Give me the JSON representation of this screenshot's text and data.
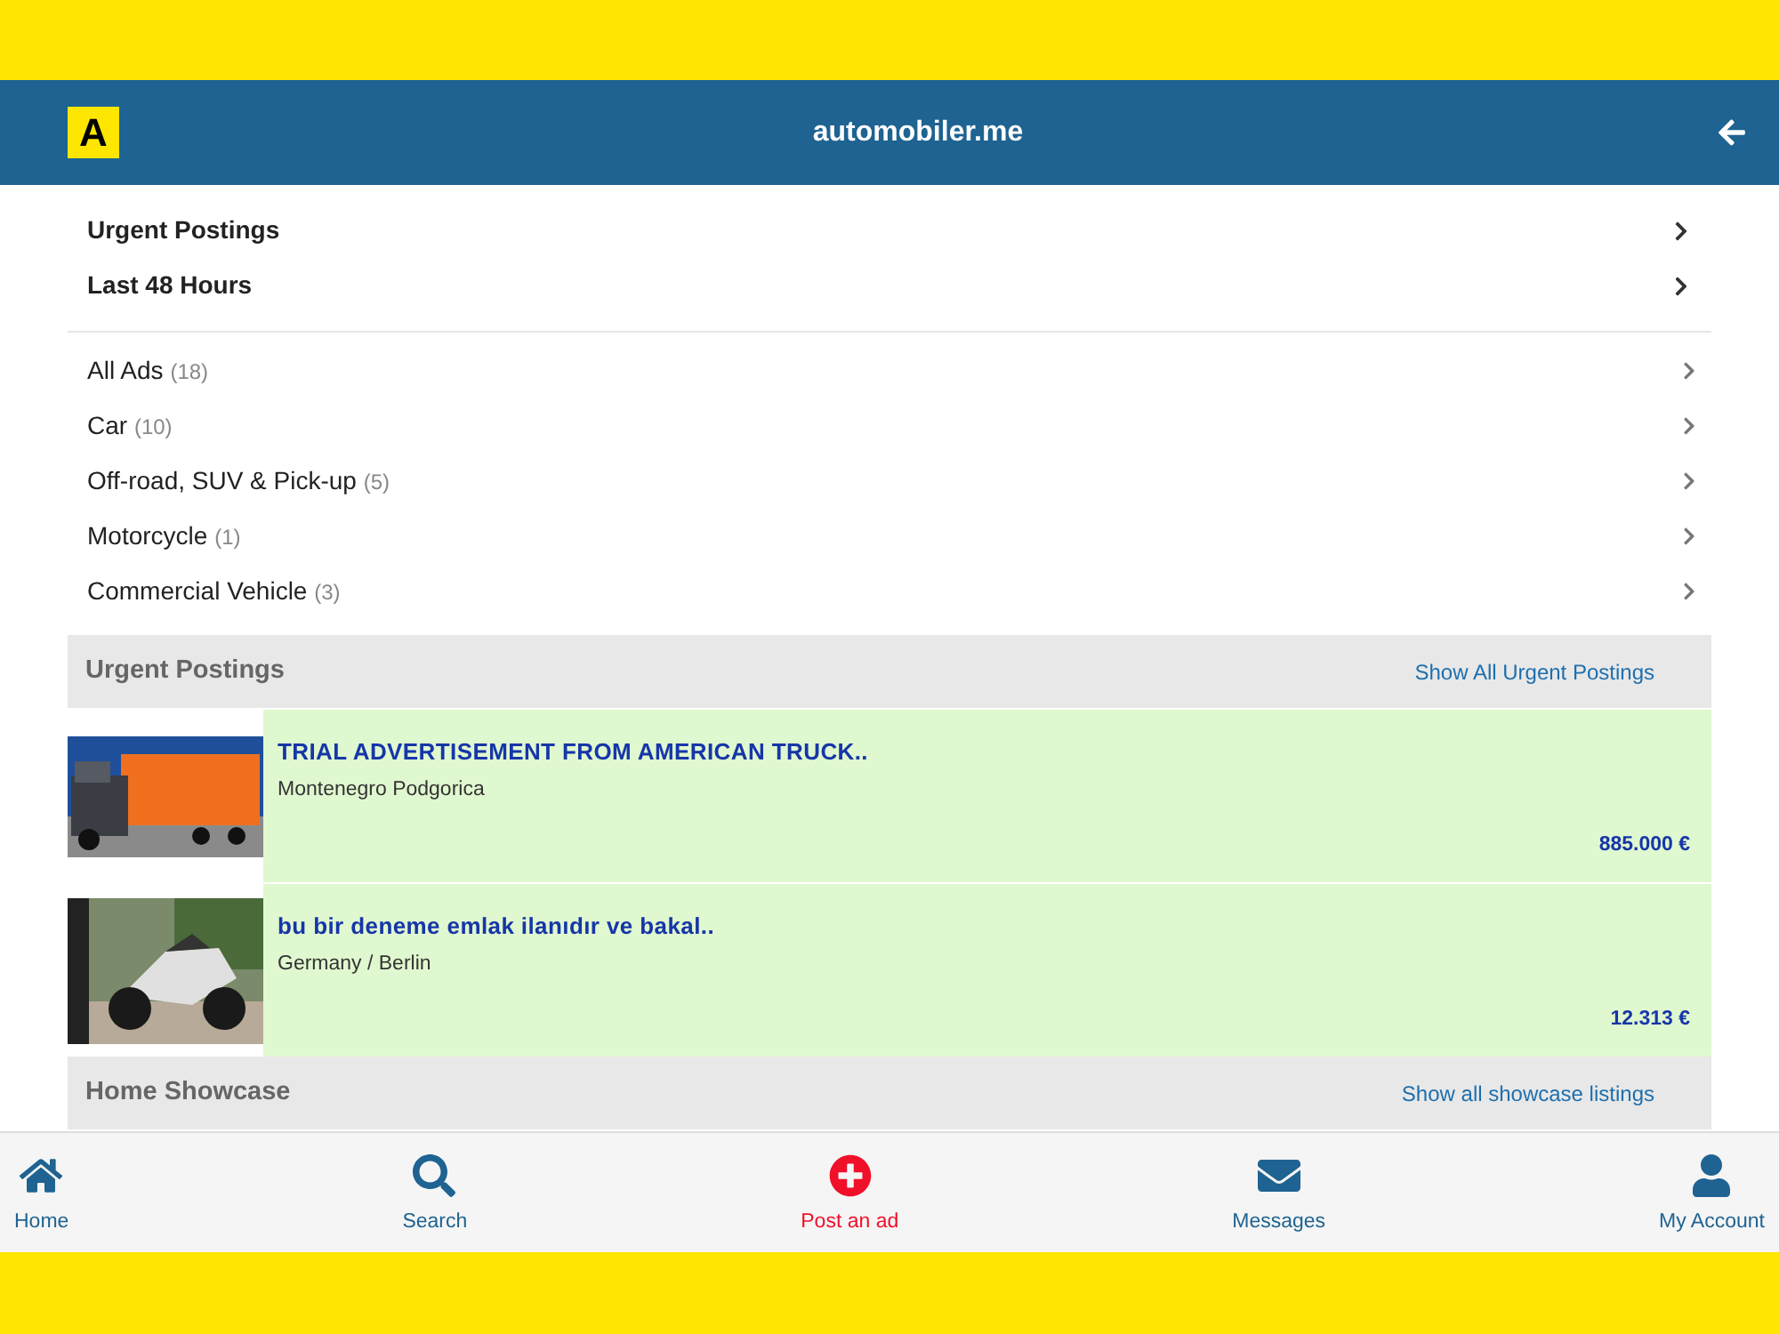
{
  "header": {
    "logo": "A",
    "title": "automobiler.me"
  },
  "quick_links": [
    {
      "label": "Urgent Postings"
    },
    {
      "label": "Last 48 Hours"
    }
  ],
  "categories": [
    {
      "label": "All Ads",
      "count": "(18)"
    },
    {
      "label": "Car",
      "count": "(10)"
    },
    {
      "label": "Off-road, SUV & Pick-up",
      "count": "(5)"
    },
    {
      "label": "Motorcycle",
      "count": "(1)"
    },
    {
      "label": "Commercial Vehicle",
      "count": "(3)"
    }
  ],
  "sections": [
    {
      "title": "Urgent Postings",
      "link": "Show All Urgent Postings",
      "listings": [
        {
          "kind": "truck",
          "title": "TRIAL ADVERTISEMENT FROM AMERICAN TRUCK..",
          "location": "Montenegro Podgorica",
          "price": "885.000 €"
        },
        {
          "kind": "motorcycle",
          "title": "bu bir deneme emlak ilanıdır ve bakal..",
          "location": "Germany / Berlin",
          "price": "12.313 €"
        }
      ]
    },
    {
      "title": "Home Showcase",
      "link": "Show all showcase listings"
    }
  ],
  "bottom_nav": [
    {
      "kind": "home",
      "label": "Home"
    },
    {
      "kind": "search",
      "label": "Search"
    },
    {
      "kind": "post",
      "label": "Post an ad"
    },
    {
      "kind": "messages",
      "label": "Messages"
    },
    {
      "kind": "account",
      "label": "My Account"
    }
  ]
}
